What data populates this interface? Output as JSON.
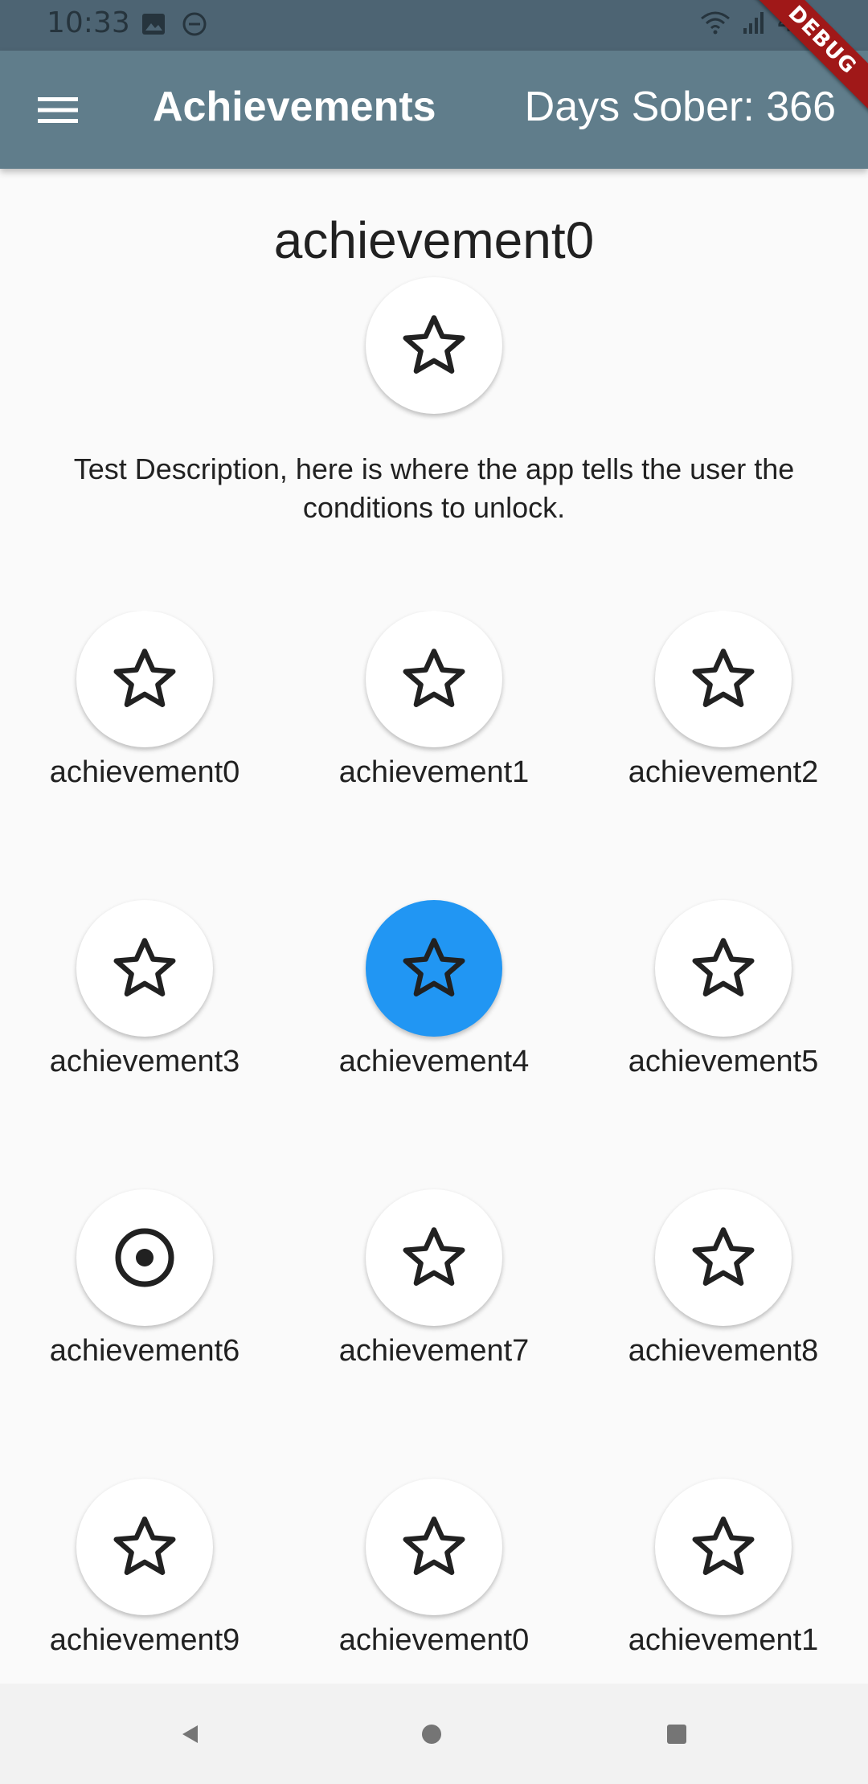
{
  "status_bar": {
    "time": "10:33",
    "battery": "42"
  },
  "app_bar": {
    "title": "Achievements",
    "days_sober": "Days Sober: 366",
    "debug_banner": "DEBUG",
    "menu_icon": "hamburger-menu-icon"
  },
  "detail": {
    "title": "achievement0",
    "icon": "star-outline-icon",
    "description": "Test Description, here is where the app tells the user the conditions to unlock."
  },
  "achievements": [
    {
      "label": "achievement0",
      "icon": "star",
      "selected": false
    },
    {
      "label": "achievement1",
      "icon": "star",
      "selected": false
    },
    {
      "label": "achievement2",
      "icon": "star",
      "selected": false
    },
    {
      "label": "achievement3",
      "icon": "star",
      "selected": false
    },
    {
      "label": "achievement4",
      "icon": "star",
      "selected": true
    },
    {
      "label": "achievement5",
      "icon": "star",
      "selected": false
    },
    {
      "label": "achievement6",
      "icon": "target",
      "selected": false
    },
    {
      "label": "achievement7",
      "icon": "star",
      "selected": false
    },
    {
      "label": "achievement8",
      "icon": "star",
      "selected": false
    },
    {
      "label": "achievement9",
      "icon": "star",
      "selected": false
    },
    {
      "label": "achievement0",
      "icon": "star",
      "selected": false
    },
    {
      "label": "achievement1",
      "icon": "star",
      "selected": false
    }
  ],
  "colors": {
    "app_bar": "#607d8b",
    "selected_badge": "#2196f3",
    "debug_ribbon": "#a01818"
  }
}
